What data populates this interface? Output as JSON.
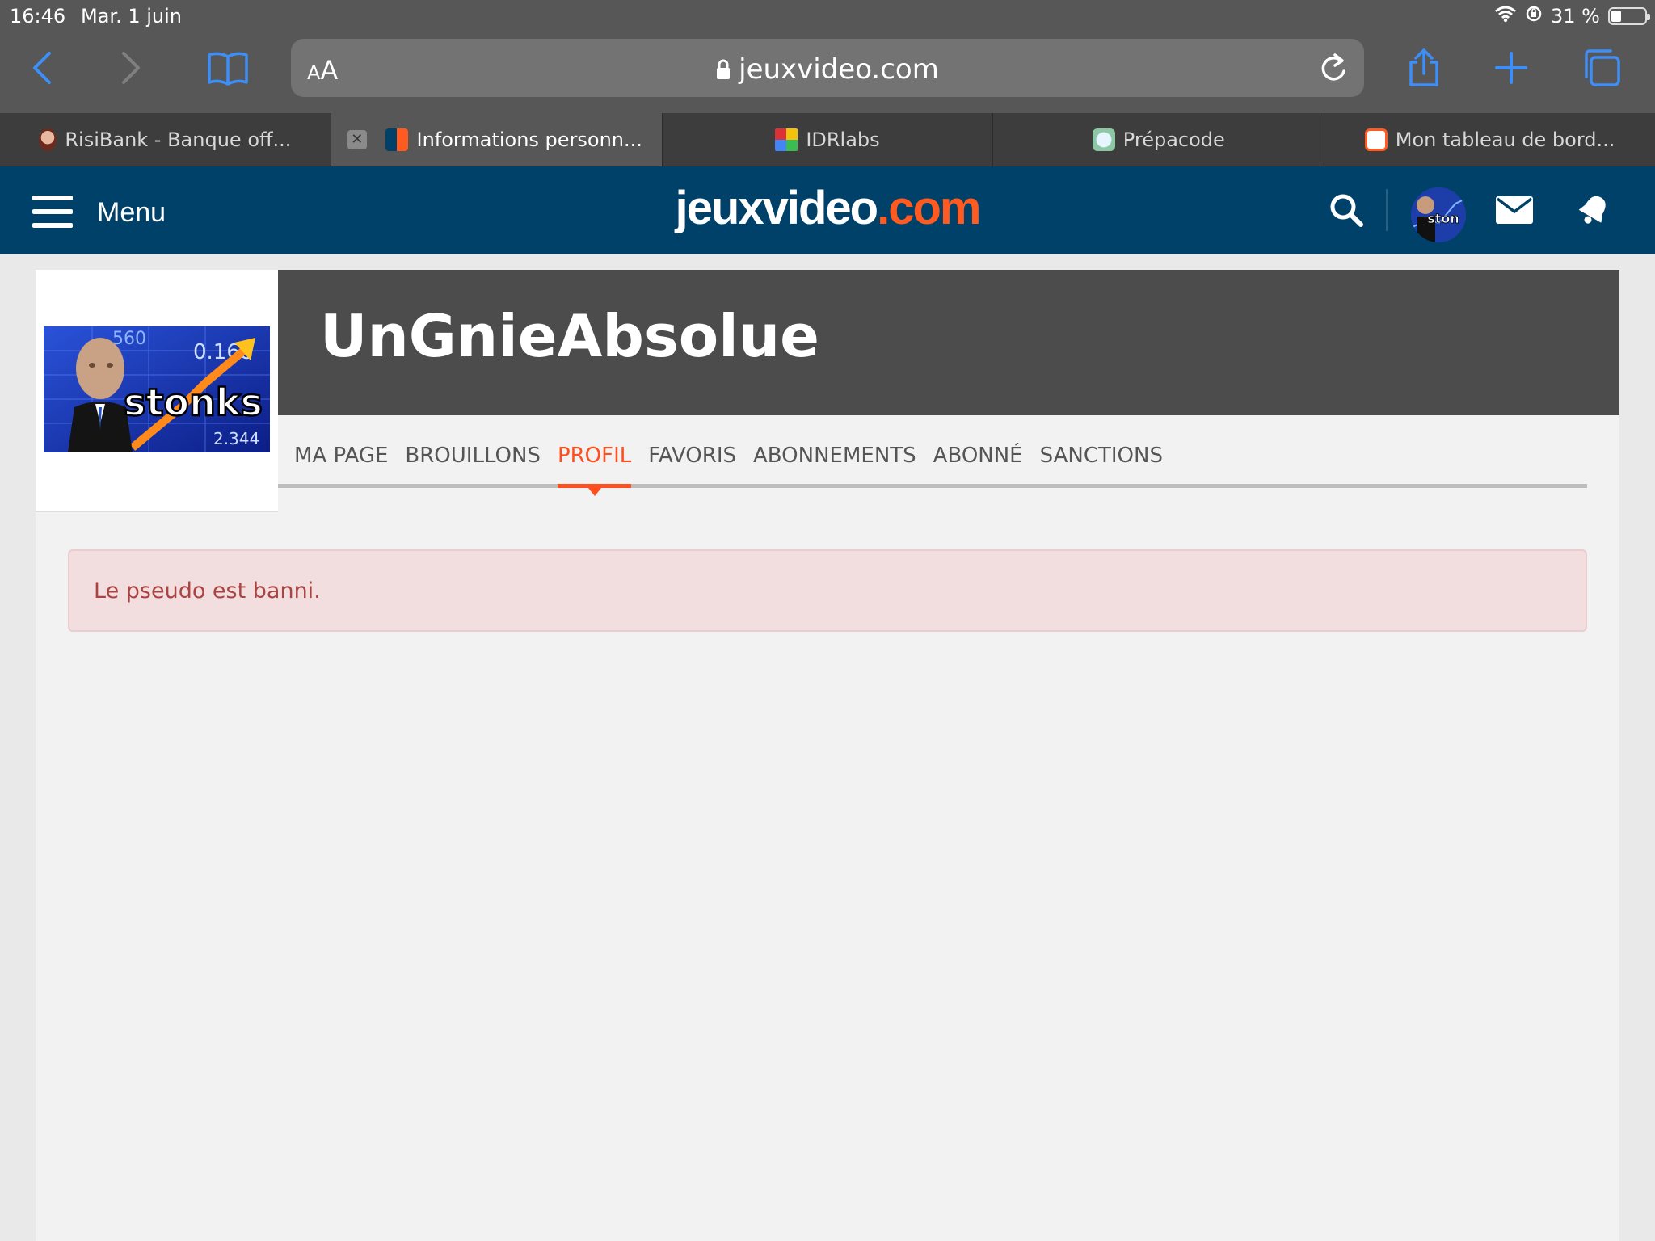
{
  "status_bar": {
    "time": "16:46",
    "date": "Mar. 1 juin",
    "battery_text": "31 %",
    "battery_level": 0.31
  },
  "browser": {
    "address_size_label_small": "A",
    "address_size_label_large": "A",
    "url": "jeuxvideo.com",
    "accent_color": "#3e8ef7"
  },
  "tabs": [
    {
      "label": "RisiBank - Banque off...",
      "favicon": "risibank-favicon",
      "active": false
    },
    {
      "label": "Informations personn...",
      "favicon": "jvc-favicon",
      "active": true
    },
    {
      "label": "IDRlabs",
      "favicon": "idrlabs-favicon",
      "active": false
    },
    {
      "label": "Prépacode",
      "favicon": "prepacode-favicon",
      "active": false
    },
    {
      "label": "Mon tableau de bord...",
      "favicon": "tableau-favicon",
      "active": false
    }
  ],
  "site_header": {
    "menu_label": "Menu",
    "logo_part1": "jeuxvideo",
    "logo_part2": ".com",
    "bg_color": "#00416a",
    "brand_color": "#ff5a1f",
    "avatar_text": "ston"
  },
  "profile": {
    "username": "UnGnieAbsolue",
    "image_caption": "stonks",
    "nav": [
      {
        "label": "MA PAGE",
        "active": false
      },
      {
        "label": "BROUILLONS",
        "active": false
      },
      {
        "label": "PROFIL",
        "active": true
      },
      {
        "label": "FAVORIS",
        "active": false
      },
      {
        "label": "ABONNEMENTS",
        "active": false
      },
      {
        "label": "ABONNÉ",
        "active": false
      },
      {
        "label": "SANCTIONS",
        "active": false
      }
    ]
  },
  "alert": {
    "message": "Le pseudo est banni.",
    "text_color": "#a94442",
    "bg_color": "#f2dede"
  }
}
